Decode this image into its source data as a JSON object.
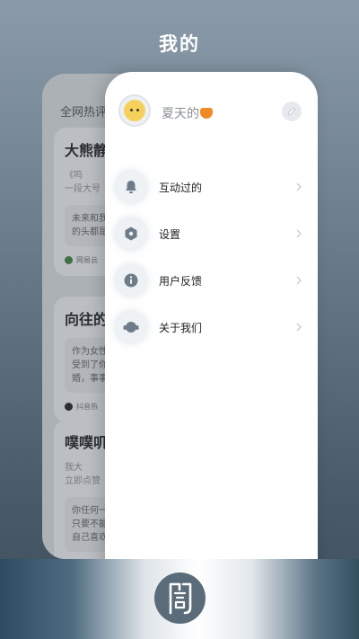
{
  "page": {
    "title": "我的"
  },
  "feed": {
    "header": "全网热评",
    "items": [
      {
        "title": "大熊静",
        "sub_line1": "《鸣",
        "sub_line2": "一段大号",
        "quote_line1": "未来和我",
        "quote_line2": "的头都是",
        "source": "网易云"
      },
      {
        "title": "向往的",
        "quote_line1": "作为女性",
        "quote_line2": "受到了你",
        "quote_line3": "婚，事事",
        "source": "抖音热"
      },
      {
        "title": "噗噗叽",
        "sub_line1": "我大",
        "sub_line2": "立即点赞",
        "quote_line1": "你任何一",
        "quote_line2": "只要不能",
        "quote_line3": "自己喜欢"
      }
    ]
  },
  "profile": {
    "username": "夏天的",
    "avatar": "yellow-cartoon-avatar",
    "fox_emoji": "fox-emoji",
    "edit_icon": "pencil-icon"
  },
  "menu": {
    "items": [
      {
        "label": "互动过的",
        "icon": "bell-icon"
      },
      {
        "label": "设置",
        "icon": "settings-icon"
      },
      {
        "label": "用户反馈",
        "icon": "info-icon"
      },
      {
        "label": "关于我们",
        "icon": "headset-icon"
      }
    ]
  },
  "app_logo": {
    "icon": "app-logo-icon"
  },
  "colors": {
    "accent": "#5a6c79",
    "menu_label": "#222222",
    "username": "#8a8f95",
    "icon": "#6d7c88"
  }
}
